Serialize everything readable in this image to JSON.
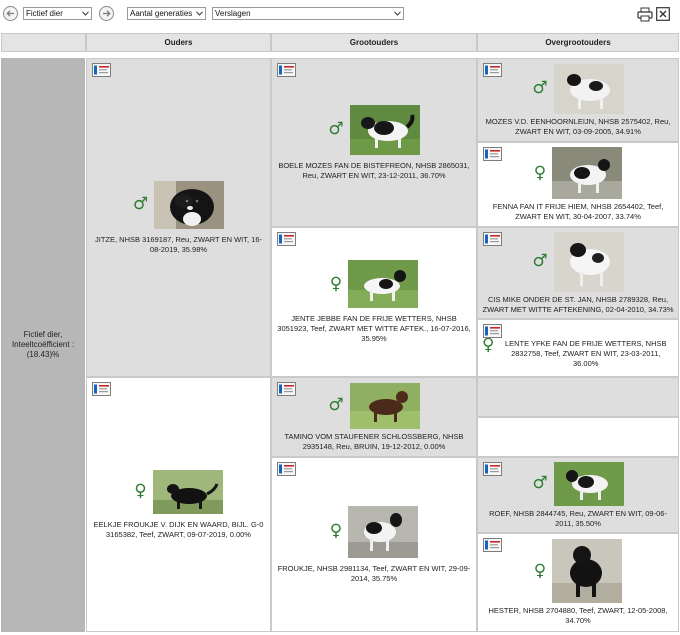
{
  "toolbar": {
    "subject_select": "Fictief dier",
    "generations_select": "Aantal generaties",
    "reports_select": "Verslagen"
  },
  "header": {
    "col_parents": "Ouders",
    "col_grandparents": "Grootouders",
    "col_greatgrandparents": "Overgrootouders"
  },
  "subject": {
    "label": "Fictief dier, Inteeltcoëfficient : (18.43)%"
  },
  "parents": [
    {
      "sex": "♂",
      "caption": "JITZE, NHSB 3169187, Reu, ZWART EN WIT, 16-08-2019, 35.98%",
      "photo": "black-white-dog-head"
    },
    {
      "sex": "♀",
      "caption": "EELKJE FROUKJE V. DIJK EN WAARD, BIJL. G-0 3165382, Teef, ZWART, 09-07-2019, 0.00%",
      "photo": "black-dog"
    }
  ],
  "grandparents": [
    {
      "sex": "♂",
      "caption": "BOELE MOZES FAN DE BISTEFREON, NHSB 2865031, Reu, ZWART EN WIT, 23-12-2011, 36.70%",
      "photo": "black-white-dog"
    },
    {
      "sex": "♀",
      "caption": "JENTE JEBBE FAN DE FRIJE WETTERS, NHSB 3051923, Teef, ZWART MET WITTE AFTEK., 16-07-2016, 35.95%",
      "photo": "black-white-dog"
    },
    {
      "sex": "♂",
      "caption": "TAMINO VOM STAUFENER SCHLOSSBERG, NHSB 2935148, Reu, BRUIN, 19-12-2012, 0.00%",
      "photo": "brown-dog"
    },
    {
      "sex": "♀",
      "caption": "FROUKJE, NHSB 2981134, Teef, ZWART EN WIT, 29-09-2014, 35.75%",
      "photo": "black-white-dog"
    }
  ],
  "greatgrandparents": [
    {
      "sex": "♂",
      "caption": "MOZES V.D. EENHOORNLEIJN, NHSB 2575402, Reu, ZWART EN WIT, 03-09-2005, 34.91%",
      "photo": "black-white-dog"
    },
    {
      "sex": "♀",
      "caption": "FENNA FAN IT FRIJE HIEM, NHSB 2654402, Teef, ZWART EN WIT, 30-04-2007, 33.74%",
      "photo": "black-white-dog"
    },
    {
      "sex": "♂",
      "caption": "CIS MIKE ONDER DE ST. JAN, NHSB 2789328, Reu, ZWART MET WITTE AFTEKENING, 02-04-2010, 34.73%",
      "photo": "black-white-dog"
    },
    {
      "sex": "♀",
      "caption": "LENTE YFKE FAN DE FRIJE WETTERS, NHSB 2832758, Teef, ZWART EN WIT, 23-03-2011, 36.00%"
    },
    {
      "caption": ""
    },
    {
      "caption": ""
    },
    {
      "sex": "♂",
      "caption": "ROEF, NHSB 2844745, Reu, ZWART EN WIT, 09-06-2011, 35.50%",
      "photo": "black-white-dog"
    },
    {
      "sex": "♀",
      "caption": "HESTER, NHSB 2704880, Teef, ZWART, 12-05-2008, 34.70%",
      "photo": "black-dog"
    }
  ],
  "colors": {
    "sex_symbol": "#2e7d32",
    "header_bg": "#e4e4e4",
    "subject_bg": "#b7b7b7",
    "cell_grey": "#dedede",
    "pedigree_icon_red": "#c62828",
    "pedigree_icon_blue": "#1565c0"
  }
}
